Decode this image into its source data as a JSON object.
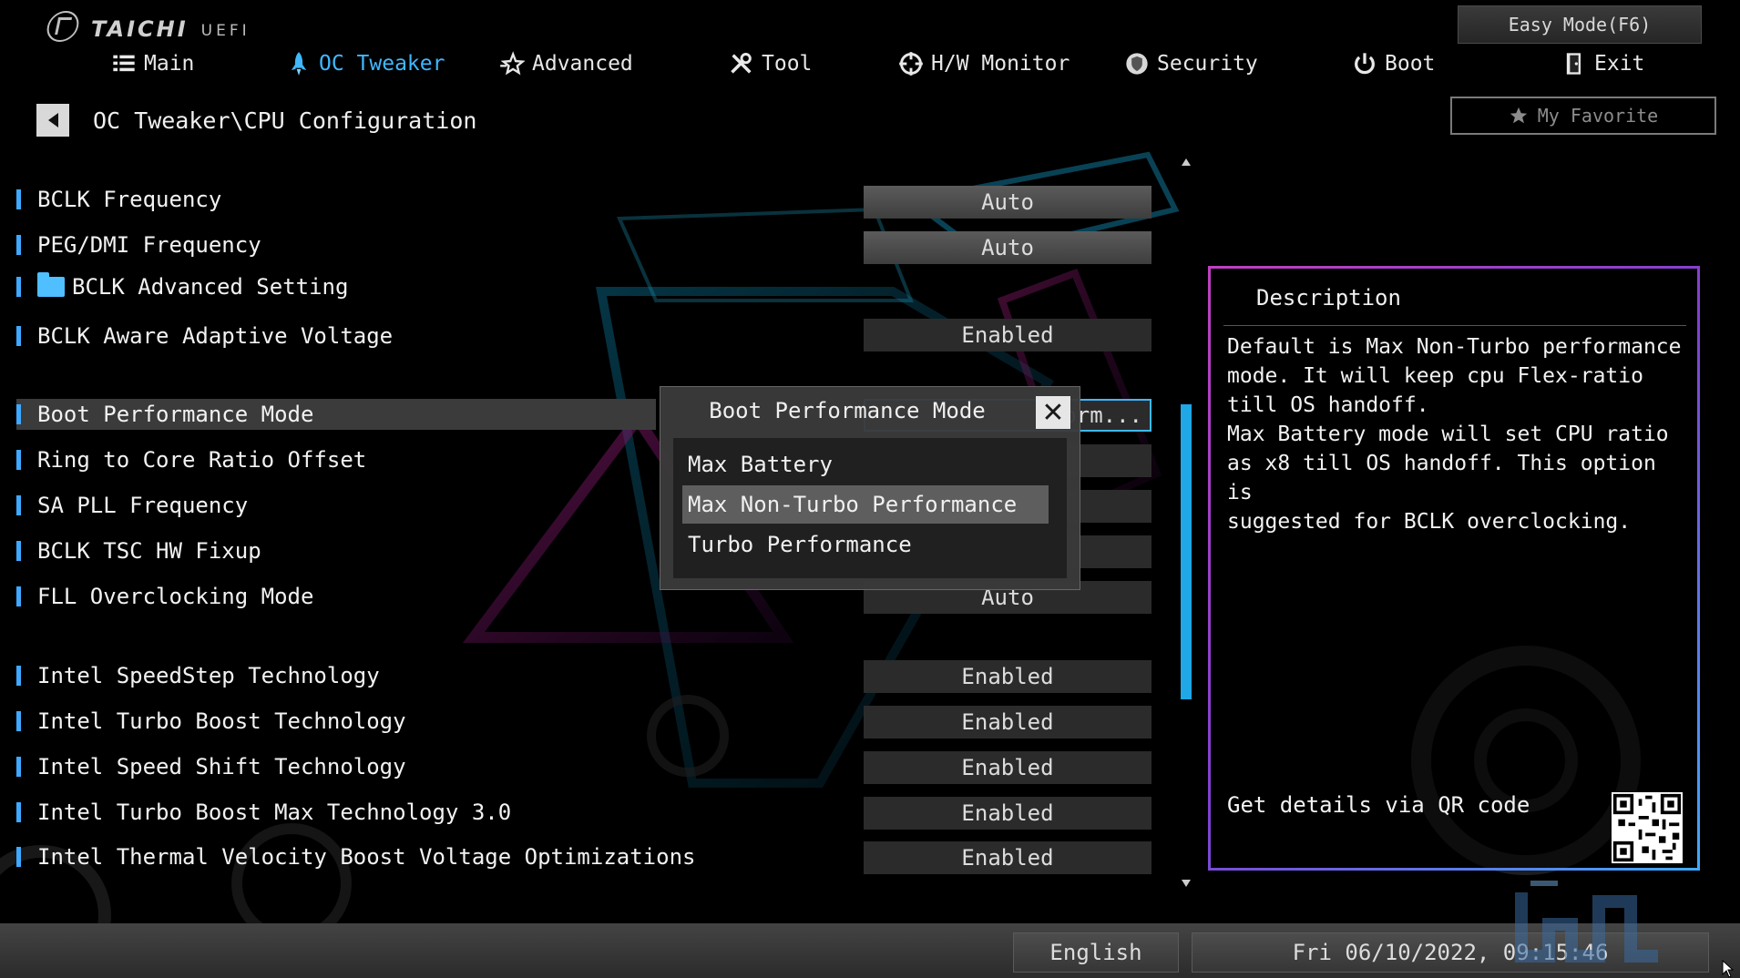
{
  "header": {
    "brand": "TAICHI",
    "brand_sub": "UEFI",
    "easy_mode": "Easy Mode(F6)",
    "my_favorite": "My Favorite"
  },
  "nav": [
    {
      "label": "Main",
      "icon": "list-icon",
      "active": false
    },
    {
      "label": "OC Tweaker",
      "icon": "rocket-icon",
      "active": true
    },
    {
      "label": "Advanced",
      "icon": "star-icon",
      "active": false
    },
    {
      "label": "Tool",
      "icon": "tools-icon",
      "active": false
    },
    {
      "label": "H/W Monitor",
      "icon": "crosshair-icon",
      "active": false
    },
    {
      "label": "Security",
      "icon": "shield-icon",
      "active": false
    },
    {
      "label": "Boot",
      "icon": "power-icon",
      "active": false
    },
    {
      "label": "Exit",
      "icon": "exit-door-icon",
      "active": false
    }
  ],
  "breadcrumb": "OC Tweaker\\CPU Configuration",
  "settings": [
    {
      "label": "BCLK Frequency",
      "value": "Auto"
    },
    {
      "label": "PEG/DMI Frequency",
      "value": "Auto"
    },
    {
      "label": "BCLK Advanced Setting",
      "value": ""
    },
    {
      "label": "BCLK Aware Adaptive Voltage",
      "value": "Enabled"
    },
    {
      "label": "Boot Performance Mode",
      "value": "orm..."
    },
    {
      "label": "Ring to Core Ratio Offset",
      "value": ""
    },
    {
      "label": "SA PLL Frequency",
      "value": ""
    },
    {
      "label": "BCLK TSC HW Fixup",
      "value": ""
    },
    {
      "label": "FLL Overclocking Mode",
      "value": "Auto"
    },
    {
      "label": "Intel SpeedStep Technology",
      "value": "Enabled"
    },
    {
      "label": "Intel Turbo Boost Technology",
      "value": "Enabled"
    },
    {
      "label": "Intel Speed Shift Technology",
      "value": "Enabled"
    },
    {
      "label": "Intel Turbo Boost Max Technology 3.0",
      "value": "Enabled"
    },
    {
      "label": "Intel Thermal Velocity Boost Voltage Optimizations",
      "value": "Enabled"
    }
  ],
  "popup": {
    "title": "Boot Performance Mode",
    "close": "✕",
    "options": [
      "Max Battery",
      "Max Non-Turbo Performance",
      "Turbo Performance"
    ],
    "selected_index": 1
  },
  "description": {
    "title": "Description",
    "body": "Default is Max Non-Turbo performance\nmode. It will keep cpu Flex-ratio\ntill OS handoff.\nMax Battery mode will set CPU ratio\nas x8 till OS handoff. This option is\nsuggested for BCLK overclocking.",
    "qr_text": "Get details via QR code"
  },
  "footer": {
    "language": "English",
    "datetime": "Fri 06/10/2022, 09:15:46"
  },
  "colors": {
    "accent": "#3fb8ff",
    "panel_border_start": "#c040c0",
    "panel_border_end": "#3fa9ff"
  }
}
